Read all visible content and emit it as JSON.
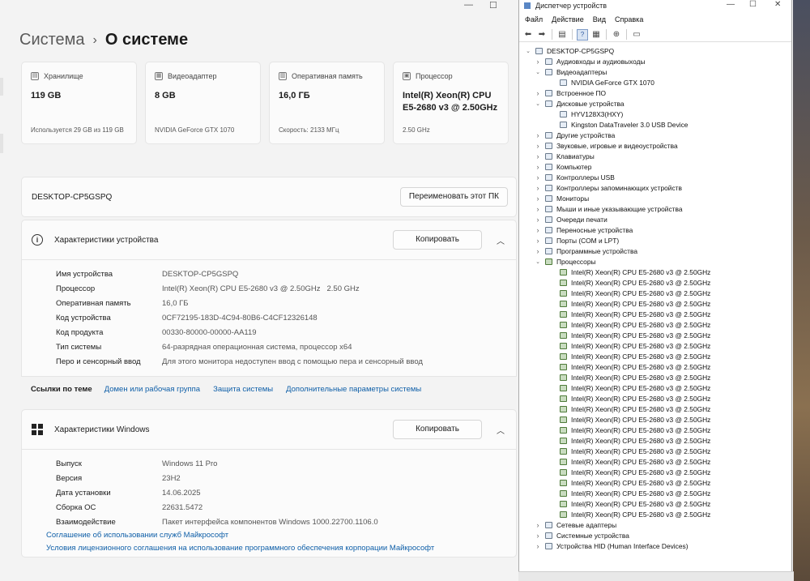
{
  "settings": {
    "breadcrumb": {
      "parent": "Система",
      "current": "О системе"
    },
    "window_controls": {
      "minimize": "—",
      "maximize": "☐"
    },
    "cards": [
      {
        "name": "storage",
        "label": "Хранилище",
        "value": "119 GB",
        "footer": "Используется 29 GB из 119 GB",
        "icon": "storage-icon"
      },
      {
        "name": "gpu",
        "label": "Видеоадаптер",
        "value": "8 GB",
        "footer": "NVIDIA GeForce GTX 1070",
        "icon": "gpu-icon"
      },
      {
        "name": "ram",
        "label": "Оперативная память",
        "value": "16,0 ГБ",
        "footer": "Скорость: 2133 МГц",
        "icon": "ram-icon"
      },
      {
        "name": "cpu",
        "label": "Процессор",
        "value": "Intel(R) Xeon(R) CPU E5-2680 v3 @ 2.50GHz",
        "footer": "2.50 GHz",
        "icon": "cpu-icon"
      }
    ],
    "pc": {
      "name": "DESKTOP-CP5GSPQ",
      "rename_label": "Переименовать этот ПК"
    },
    "device_specs": {
      "title": "Характеристики устройства",
      "copy_label": "Копировать",
      "rows": [
        {
          "key": "Имя устройства",
          "value": "DESKTOP-CP5GSPQ",
          "extra": ""
        },
        {
          "key": "Процессор",
          "value": "Intel(R) Xeon(R) CPU E5-2680 v3 @ 2.50GHz",
          "extra": "2.50 GHz"
        },
        {
          "key": "Оперативная память",
          "value": "16,0 ГБ",
          "extra": ""
        },
        {
          "key": "Код устройства",
          "value": "0CF72195-183D-4C94-80B6-C4CF12326148",
          "extra": ""
        },
        {
          "key": "Код продукта",
          "value": "00330-80000-00000-AA119",
          "extra": ""
        },
        {
          "key": "Тип системы",
          "value": "64-разрядная операционная система, процессор x64",
          "extra": ""
        },
        {
          "key": "Перо и сенсорный ввод",
          "value": "Для этого монитора недоступен ввод с помощью пера и сенсорный ввод",
          "extra": ""
        }
      ]
    },
    "related_links": {
      "label": "Ссылки по теме",
      "links": [
        "Домен или рабочая группа",
        "Защита системы",
        "Дополнительные параметры системы"
      ]
    },
    "windows_specs": {
      "title": "Характеристики Windows",
      "copy_label": "Копировать",
      "rows": [
        {
          "key": "Выпуск",
          "value": "Windows 11 Pro"
        },
        {
          "key": "Версия",
          "value": "23H2"
        },
        {
          "key": "Дата установки",
          "value": "14.06.2025"
        },
        {
          "key": "Сборка ОС",
          "value": "22631.5472"
        },
        {
          "key": "Взаимодействие",
          "value": "Пакет интерфейса компонентов Windows 1000.22700.1106.0"
        }
      ],
      "links": [
        "Соглашение об использовании служб Майкрософт",
        "Условия лицензионного соглашения на использование программного обеспечения корпорации Майкрософт"
      ]
    }
  },
  "device_manager": {
    "title": "Диспетчер устройств",
    "window_controls": {
      "minimize": "—",
      "maximize": "☐",
      "close": "✕"
    },
    "menu": [
      "Файл",
      "Действие",
      "Вид",
      "Справка"
    ],
    "toolbar": [
      "arrow-left-icon",
      "arrow-right-icon",
      "properties-icon",
      "help-icon",
      "scan-icon",
      "add-hardware-icon",
      "monitor-icon"
    ],
    "tree": [
      {
        "level": 0,
        "label": "DESKTOP-CP5GSPQ",
        "toggle": "expanded",
        "icon": "computer-icon"
      },
      {
        "level": 1,
        "label": "Аудиовходы и аудиовыходы",
        "toggle": "collapsed",
        "icon": "audio-icon"
      },
      {
        "level": 1,
        "label": "Видеоадаптеры",
        "toggle": "expanded",
        "icon": "display-adapter-icon"
      },
      {
        "level": 2,
        "label": "NVIDIA GeForce GTX 1070",
        "toggle": "none",
        "icon": "display-adapter-icon"
      },
      {
        "level": 1,
        "label": "Встроенное ПО",
        "toggle": "collapsed",
        "icon": "firmware-icon"
      },
      {
        "level": 1,
        "label": "Дисковые устройства",
        "toggle": "expanded",
        "icon": "disk-icon"
      },
      {
        "level": 2,
        "label": "HYV128X3(HXY)",
        "toggle": "none",
        "icon": "disk-icon"
      },
      {
        "level": 2,
        "label": "Kingston DataTraveler 3.0 USB Device",
        "toggle": "none",
        "icon": "disk-icon"
      },
      {
        "level": 1,
        "label": "Другие устройства",
        "toggle": "collapsed",
        "icon": "other-devices-icon"
      },
      {
        "level": 1,
        "label": "Звуковые, игровые и видеоустройства",
        "toggle": "collapsed",
        "icon": "sound-icon"
      },
      {
        "level": 1,
        "label": "Клавиатуры",
        "toggle": "collapsed",
        "icon": "keyboard-icon"
      },
      {
        "level": 1,
        "label": "Компьютер",
        "toggle": "collapsed",
        "icon": "computer-icon"
      },
      {
        "level": 1,
        "label": "Контроллеры USB",
        "toggle": "collapsed",
        "icon": "usb-icon"
      },
      {
        "level": 1,
        "label": "Контроллеры запоминающих устройств",
        "toggle": "collapsed",
        "icon": "storage-controller-icon"
      },
      {
        "level": 1,
        "label": "Мониторы",
        "toggle": "collapsed",
        "icon": "monitor-icon"
      },
      {
        "level": 1,
        "label": "Мыши и иные указывающие устройства",
        "toggle": "collapsed",
        "icon": "mouse-icon"
      },
      {
        "level": 1,
        "label": "Очереди печати",
        "toggle": "collapsed",
        "icon": "printer-icon"
      },
      {
        "level": 1,
        "label": "Переносные устройства",
        "toggle": "collapsed",
        "icon": "portable-device-icon"
      },
      {
        "level": 1,
        "label": "Порты (COM и LPT)",
        "toggle": "collapsed",
        "icon": "port-icon"
      },
      {
        "level": 1,
        "label": "Программные устройства",
        "toggle": "collapsed",
        "icon": "software-device-icon"
      },
      {
        "level": 1,
        "label": "Процессоры",
        "toggle": "expanded",
        "icon": "cpu-icon"
      },
      {
        "level": 2,
        "label": "Intel(R) Xeon(R) CPU E5-2680 v3 @ 2.50GHz",
        "toggle": "none",
        "icon": "cpu-icon"
      },
      {
        "level": 2,
        "label": "Intel(R) Xeon(R) CPU E5-2680 v3 @ 2.50GHz",
        "toggle": "none",
        "icon": "cpu-icon"
      },
      {
        "level": 2,
        "label": "Intel(R) Xeon(R) CPU E5-2680 v3 @ 2.50GHz",
        "toggle": "none",
        "icon": "cpu-icon"
      },
      {
        "level": 2,
        "label": "Intel(R) Xeon(R) CPU E5-2680 v3 @ 2.50GHz",
        "toggle": "none",
        "icon": "cpu-icon"
      },
      {
        "level": 2,
        "label": "Intel(R) Xeon(R) CPU E5-2680 v3 @ 2.50GHz",
        "toggle": "none",
        "icon": "cpu-icon"
      },
      {
        "level": 2,
        "label": "Intel(R) Xeon(R) CPU E5-2680 v3 @ 2.50GHz",
        "toggle": "none",
        "icon": "cpu-icon"
      },
      {
        "level": 2,
        "label": "Intel(R) Xeon(R) CPU E5-2680 v3 @ 2.50GHz",
        "toggle": "none",
        "icon": "cpu-icon"
      },
      {
        "level": 2,
        "label": "Intel(R) Xeon(R) CPU E5-2680 v3 @ 2.50GHz",
        "toggle": "none",
        "icon": "cpu-icon"
      },
      {
        "level": 2,
        "label": "Intel(R) Xeon(R) CPU E5-2680 v3 @ 2.50GHz",
        "toggle": "none",
        "icon": "cpu-icon"
      },
      {
        "level": 2,
        "label": "Intel(R) Xeon(R) CPU E5-2680 v3 @ 2.50GHz",
        "toggle": "none",
        "icon": "cpu-icon"
      },
      {
        "level": 2,
        "label": "Intel(R) Xeon(R) CPU E5-2680 v3 @ 2.50GHz",
        "toggle": "none",
        "icon": "cpu-icon"
      },
      {
        "level": 2,
        "label": "Intel(R) Xeon(R) CPU E5-2680 v3 @ 2.50GHz",
        "toggle": "none",
        "icon": "cpu-icon"
      },
      {
        "level": 2,
        "label": "Intel(R) Xeon(R) CPU E5-2680 v3 @ 2.50GHz",
        "toggle": "none",
        "icon": "cpu-icon"
      },
      {
        "level": 2,
        "label": "Intel(R) Xeon(R) CPU E5-2680 v3 @ 2.50GHz",
        "toggle": "none",
        "icon": "cpu-icon"
      },
      {
        "level": 2,
        "label": "Intel(R) Xeon(R) CPU E5-2680 v3 @ 2.50GHz",
        "toggle": "none",
        "icon": "cpu-icon"
      },
      {
        "level": 2,
        "label": "Intel(R) Xeon(R) CPU E5-2680 v3 @ 2.50GHz",
        "toggle": "none",
        "icon": "cpu-icon"
      },
      {
        "level": 2,
        "label": "Intel(R) Xeon(R) CPU E5-2680 v3 @ 2.50GHz",
        "toggle": "none",
        "icon": "cpu-icon"
      },
      {
        "level": 2,
        "label": "Intel(R) Xeon(R) CPU E5-2680 v3 @ 2.50GHz",
        "toggle": "none",
        "icon": "cpu-icon"
      },
      {
        "level": 2,
        "label": "Intel(R) Xeon(R) CPU E5-2680 v3 @ 2.50GHz",
        "toggle": "none",
        "icon": "cpu-icon"
      },
      {
        "level": 2,
        "label": "Intel(R) Xeon(R) CPU E5-2680 v3 @ 2.50GHz",
        "toggle": "none",
        "icon": "cpu-icon"
      },
      {
        "level": 2,
        "label": "Intel(R) Xeon(R) CPU E5-2680 v3 @ 2.50GHz",
        "toggle": "none",
        "icon": "cpu-icon"
      },
      {
        "level": 2,
        "label": "Intel(R) Xeon(R) CPU E5-2680 v3 @ 2.50GHz",
        "toggle": "none",
        "icon": "cpu-icon"
      },
      {
        "level": 2,
        "label": "Intel(R) Xeon(R) CPU E5-2680 v3 @ 2.50GHz",
        "toggle": "none",
        "icon": "cpu-icon"
      },
      {
        "level": 2,
        "label": "Intel(R) Xeon(R) CPU E5-2680 v3 @ 2.50GHz",
        "toggle": "none",
        "icon": "cpu-icon"
      },
      {
        "level": 1,
        "label": "Сетевые адаптеры",
        "toggle": "collapsed",
        "icon": "network-adapter-icon"
      },
      {
        "level": 1,
        "label": "Системные устройства",
        "toggle": "collapsed",
        "icon": "system-device-icon"
      },
      {
        "level": 1,
        "label": "Устройства HID (Human Interface Devices)",
        "toggle": "collapsed",
        "icon": "hid-icon"
      }
    ]
  }
}
